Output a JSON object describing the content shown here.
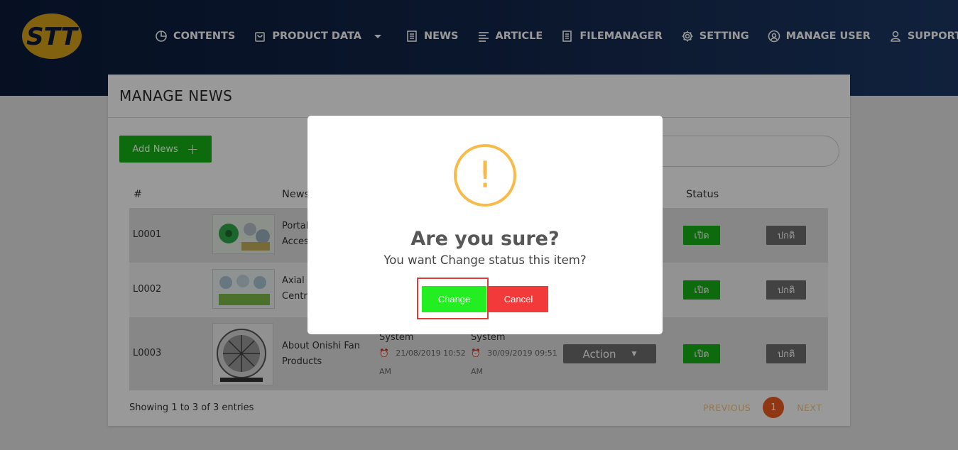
{
  "header": {
    "logo_text": "STT",
    "nav": [
      {
        "label": "CONTENTS",
        "icon": "pie-chart-icon"
      },
      {
        "label": "PRODUCT DATA",
        "icon": "bag-icon",
        "dropdown": true
      },
      {
        "label": "NEWS",
        "icon": "newspaper-icon"
      },
      {
        "label": "ARTICLE",
        "icon": "text-lines-icon"
      },
      {
        "label": "FILEMANAGER",
        "icon": "document-icon"
      },
      {
        "label": "SETTING",
        "icon": "gear-icon"
      },
      {
        "label": "MANAGE USER",
        "icon": "user-circle-icon"
      },
      {
        "label": "SUPPORT",
        "icon": "user-icon",
        "dropdown": true
      }
    ]
  },
  "page": {
    "title": "MANAGE NEWS",
    "add_button": "Add News",
    "columns": {
      "id": "#",
      "news": "News",
      "status": "Status"
    },
    "rows": [
      {
        "id": "L0001",
        "title_line1": "Portal",
        "title_line2": "Acces",
        "status_on": "เปิด",
        "status_off": "ปกติ"
      },
      {
        "id": "L0002",
        "title_line1": "Axial",
        "title_line2": "Centr",
        "status_on": "เปิด",
        "status_off": "ปกติ"
      },
      {
        "id": "L0003",
        "title_line1": "About Onishi Fan",
        "title_line2": "Products",
        "created_by": "System",
        "created_date": "21/08/2019 10:52",
        "created_ampm": "AM",
        "updated_by": "System",
        "updated_date": "30/09/2019 09:51",
        "updated_ampm": "AM",
        "action": "Action",
        "status_on": "เปิด",
        "status_off": "ปกติ"
      }
    ],
    "showing": "Showing 1 to 3 of 3 entries",
    "pagination": {
      "previous": "PREVIOUS",
      "current": "1",
      "next": "NEXT"
    }
  },
  "modal": {
    "icon": "warning-icon",
    "icon_glyph": "!",
    "title": "Are you sure?",
    "text": "You want Change status this item?",
    "confirm": "Change",
    "cancel": "Cancel"
  },
  "colors": {
    "header_bg": "#13274c",
    "green": "#16b316",
    "confirm_green": "#22ee22",
    "cancel_red": "#f23a3a",
    "warning": "#f8bb4a",
    "logo_gold": "#d9a21a",
    "pager_active": "#ef5a1f"
  }
}
